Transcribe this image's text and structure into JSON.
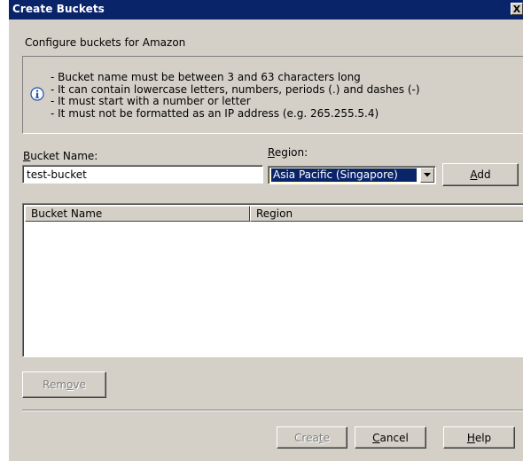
{
  "window": {
    "title": "Create Buckets",
    "close_glyph": "X"
  },
  "subheading": "Configure buckets for Amazon",
  "info": {
    "icon": "info-icon",
    "lines": [
      "- Bucket name must be between 3 and 63 characters long",
      "- It can contain lowercase letters, numbers, periods (.) and dashes (-)",
      "- It must start with a number or letter",
      "- It must not be formatted as an IP address (e.g. 265.255.5.4)"
    ]
  },
  "form": {
    "bucket_name_label": "Bucket Name:",
    "bucket_name_value": "test-bucket",
    "region_label": "Region:",
    "region_selected": "Asia Pacific (Singapore)",
    "add_button": "Add"
  },
  "table": {
    "columns": [
      "Bucket Name",
      "Region"
    ],
    "rows": []
  },
  "buttons": {
    "remove": "Remove",
    "create": "Create",
    "cancel": "Cancel",
    "help": "Help"
  },
  "colors": {
    "title_bar": "#0a246a",
    "dialog_face": "#d4d0c8",
    "selection": "#0a246a"
  }
}
